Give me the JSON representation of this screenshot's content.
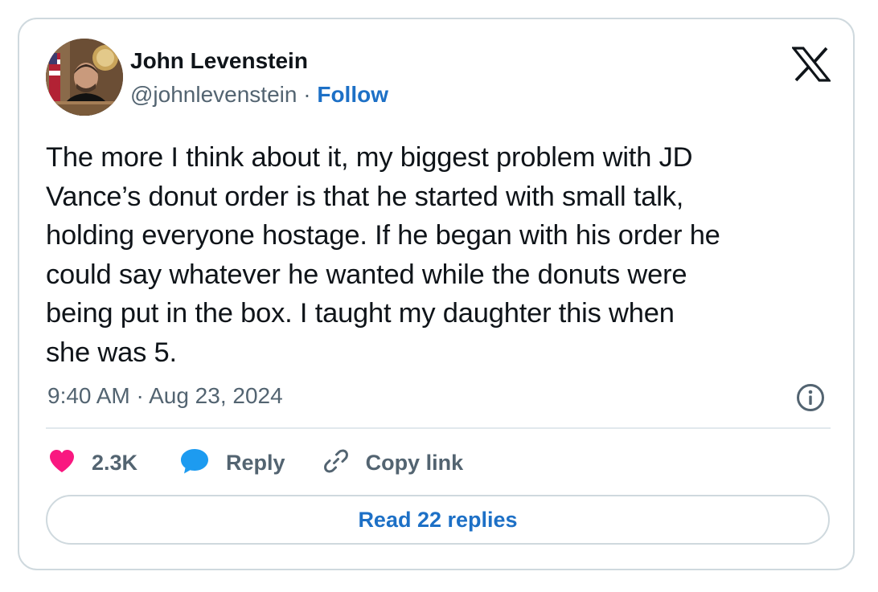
{
  "author": {
    "name": "John Levenstein",
    "handle": "@johnlevenstein",
    "separator": "·",
    "follow_label": "Follow",
    "avatar_icon": "user-avatar"
  },
  "tweet": {
    "text_lines": [
      "The more I think about it, my biggest problem with JD",
      "Vance’s donut order is that he started with small talk,",
      "holding everyone hostage. If he began with his order he",
      "could say whatever he wanted while the donuts were",
      "being put in the box. I taught my daughter this when",
      "she was 5."
    ],
    "timestamp": "9:40 AM · Aug 23, 2024"
  },
  "actions": {
    "like_count": "2.3K",
    "reply_label": "Reply",
    "copy_link_label": "Copy link"
  },
  "footer": {
    "read_replies_label": "Read 22 replies"
  },
  "icons": {
    "brand_logo": "x-logo-icon",
    "info": "info-icon",
    "like": "heart-icon",
    "reply": "speech-bubble-icon",
    "copy_link": "link-icon"
  },
  "colors": {
    "like": "#f91880",
    "reply": "#1d9bf0",
    "link": "#1d70c6",
    "muted": "#536471",
    "text": "#0f1419",
    "border": "#cfd9de"
  }
}
